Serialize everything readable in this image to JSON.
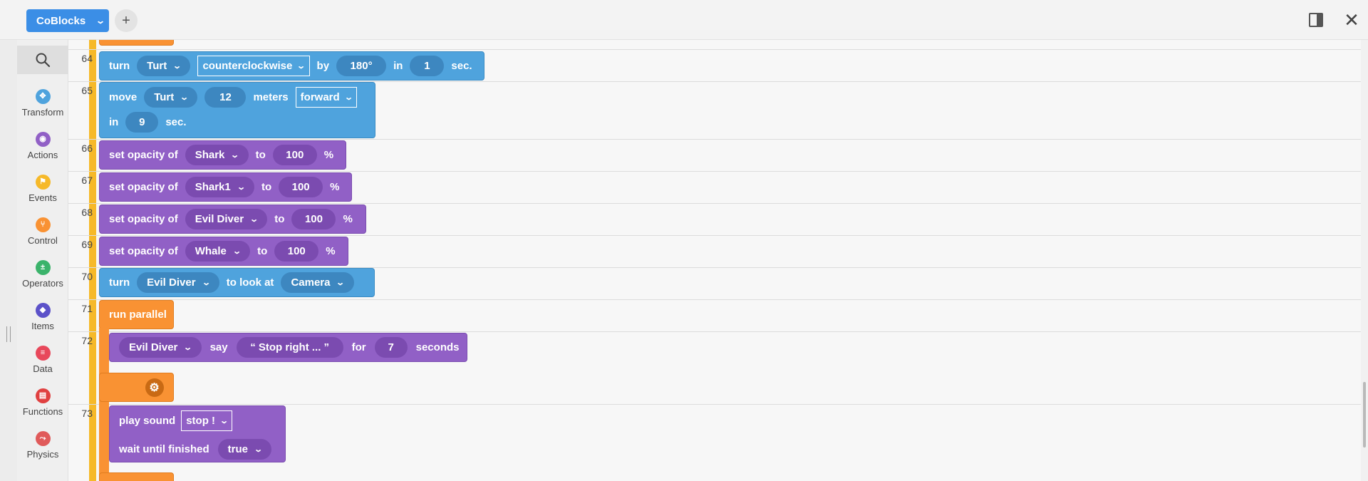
{
  "app": {
    "project_name": "CoBlocks",
    "add_label": "+",
    "close_label": "✕"
  },
  "categories": [
    {
      "label": "Transform",
      "icon": "transform-icon",
      "color": "#4fa3dd",
      "glyph": "✥"
    },
    {
      "label": "Actions",
      "icon": "eye-icon",
      "color": "#9160c6",
      "glyph": "◉"
    },
    {
      "label": "Events",
      "icon": "flag-icon",
      "color": "#f6b929",
      "glyph": "⚑"
    },
    {
      "label": "Control",
      "icon": "branch-icon",
      "color": "#f99233",
      "glyph": "⑂"
    },
    {
      "label": "Operators",
      "icon": "operators-icon",
      "color": "#3bb36b",
      "glyph": "±"
    },
    {
      "label": "Items",
      "icon": "cube-icon",
      "color": "#5c52c9",
      "glyph": "◆"
    },
    {
      "label": "Data",
      "icon": "list-icon",
      "color": "#e8485b",
      "glyph": "≡"
    },
    {
      "label": "Functions",
      "icon": "book-icon",
      "color": "#e04040",
      "glyph": "▤"
    },
    {
      "label": "Physics",
      "icon": "physics-icon",
      "color": "#e05a5a",
      "glyph": "⤳"
    }
  ],
  "lines": [
    "64",
    "65",
    "66",
    "67",
    "68",
    "69",
    "70",
    "71",
    "72",
    "73"
  ],
  "blocks": {
    "b64": {
      "verb": "turn",
      "target": "Turt",
      "direction": "counterclockwise",
      "by": "by",
      "amount": "180°",
      "in": "in",
      "duration": "1",
      "unit": "sec."
    },
    "b65": {
      "verb": "move",
      "target": "Turt",
      "distance": "12",
      "meters": "meters",
      "direction": "forward",
      "in": "in",
      "duration": "9",
      "unit": "sec."
    },
    "b66": {
      "verb": "set opacity of",
      "target": "Shark",
      "to": "to",
      "value": "100",
      "pct": "%"
    },
    "b67": {
      "verb": "set opacity of",
      "target": "Shark1",
      "to": "to",
      "value": "100",
      "pct": "%"
    },
    "b68": {
      "verb": "set opacity of",
      "target": "Evil Diver",
      "to": "to",
      "value": "100",
      "pct": "%"
    },
    "b69": {
      "verb": "set opacity of",
      "target": "Whale",
      "to": "to",
      "value": "100",
      "pct": "%"
    },
    "b70": {
      "verb": "turn",
      "target": "Evil Diver",
      "mid": "to look at",
      "object": "Camera"
    },
    "b71": {
      "label": "run parallel"
    },
    "b72": {
      "target": "Evil Diver",
      "say": "say",
      "text": "“ Stop right ... ”",
      "for": "for",
      "duration": "7",
      "unit": "seconds"
    },
    "b73": {
      "verb": "play sound",
      "sound": "stop !",
      "wait": "wait until finished",
      "wait_value": "true"
    }
  }
}
